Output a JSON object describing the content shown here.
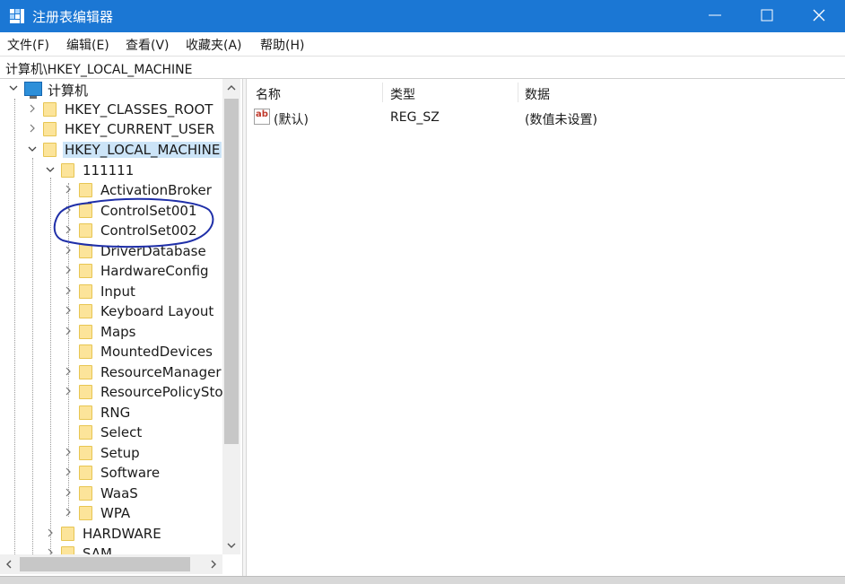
{
  "window": {
    "title": "注册表编辑器"
  },
  "menu": [
    "文件(F)",
    "编辑(E)",
    "查看(V)",
    "收藏夹(A)",
    "帮助(H)"
  ],
  "address": "计算机\\HKEY_LOCAL_MACHINE",
  "tree": {
    "root": "计算机",
    "hives": [
      "HKEY_CLASSES_ROOT",
      "HKEY_CURRENT_USER",
      "HKEY_LOCAL_MACHINE"
    ],
    "key_111111": "111111",
    "children": [
      "ActivationBroker",
      "ControlSet001",
      "ControlSet002",
      "DriverDatabase",
      "HardwareConfig",
      "Input",
      "Keyboard Layout",
      "Maps",
      "MountedDevices",
      "ResourceManager",
      "ResourcePolicySto",
      "RNG",
      "Select",
      "Setup",
      "Software",
      "WaaS",
      "WPA"
    ],
    "more": [
      "HARDWARE",
      "SAM"
    ]
  },
  "list": {
    "headers": {
      "name": "名称",
      "type": "类型",
      "data": "数据"
    },
    "rows": [
      {
        "name": "(默认)",
        "type": "REG_SZ",
        "data": "(数值未设置)"
      }
    ]
  },
  "colors": {
    "titlebar": "#1b77d4",
    "selection": "#cce4f7",
    "annotation": "#1f2fa8",
    "folder": "#fce49a"
  }
}
